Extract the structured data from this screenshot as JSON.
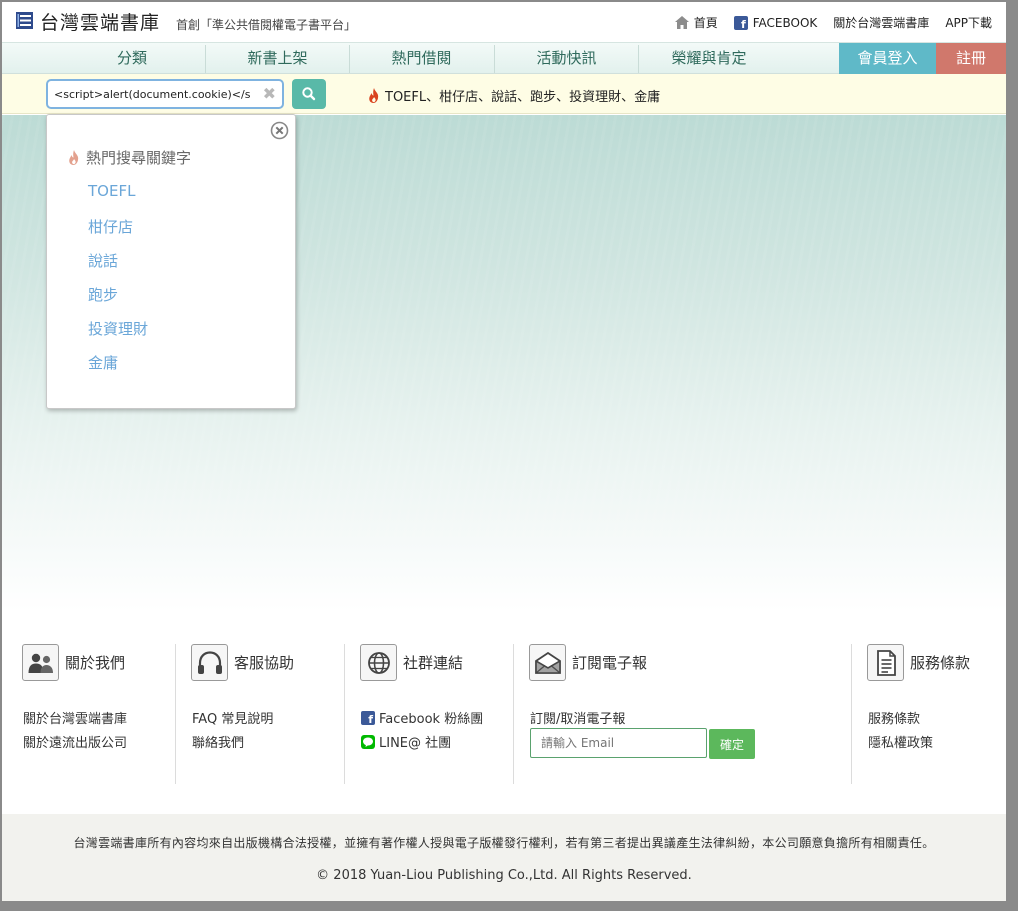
{
  "header": {
    "site_title": "台灣雲端書庫",
    "slogan": "首創「準公共借閱權電子書平台」",
    "links": {
      "home": "首頁",
      "facebook": "FACEBOOK",
      "about": "關於台灣雲端書庫",
      "app": "APP下載"
    }
  },
  "nav": {
    "items": [
      "分類",
      "新書上架",
      "熱門借閱",
      "活動快訊",
      "榮耀與肯定"
    ],
    "login": "會員登入",
    "register": "註冊"
  },
  "search": {
    "value": "<script>alert(document.cookie)</s",
    "hot_inline": "TOEFL、柑仔店、說話、跑步、投資理財、金庸"
  },
  "dropdown": {
    "title": "熱門搜尋關鍵字",
    "keywords": [
      "TOEFL",
      "柑仔店",
      "說話",
      "跑步",
      "投資理財",
      "金庸"
    ]
  },
  "footer": {
    "about": {
      "title": "關於我們",
      "links": [
        "關於台灣雲端書庫",
        "關於遠流出版公司"
      ]
    },
    "support": {
      "title": "客服協助",
      "links": [
        "FAQ 常見說明",
        "聯絡我們"
      ]
    },
    "social": {
      "title": "社群連結",
      "links": [
        "Facebook 粉絲團",
        "LINE@ 社團"
      ]
    },
    "newsletter": {
      "title": "訂閱電子報",
      "link": "訂閱/取消電子報",
      "placeholder": "請輸入 Email",
      "submit": "確定"
    },
    "terms": {
      "title": "服務條款",
      "links": [
        "服務條款",
        "隱私權政策"
      ]
    }
  },
  "bottom": {
    "disclaimer": "台灣雲端書庫所有內容均來自出版機構合法授權，並擁有著作權人授與電子版權發行權利，若有第三者提出異議產生法律糾紛，本公司願意負擔所有相關責任。",
    "copyright": "© 2018 Yuan-Liou Publishing Co.,Ltd. All Rights Reserved."
  },
  "colors": {
    "login_bg": "#5fb9c8",
    "register_bg": "#d0786c",
    "search_btn": "#59b9a8",
    "keyword_link": "#6aa6d8",
    "submit_bg": "#5cb85c"
  }
}
